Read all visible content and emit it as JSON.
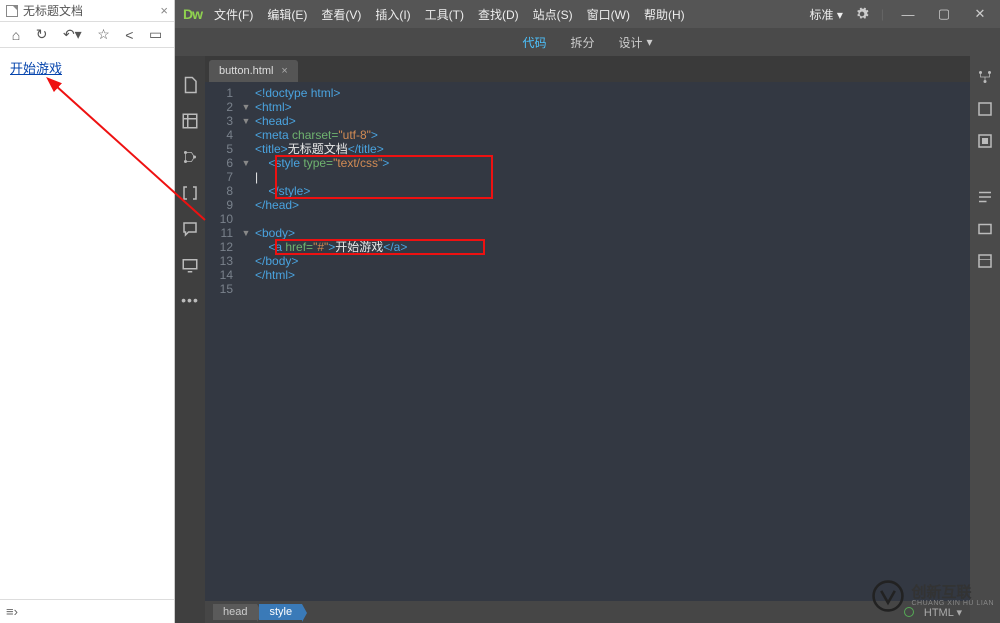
{
  "preview": {
    "title": "无标题文档",
    "link_text": "开始游戏",
    "bottom_icon": "≡›"
  },
  "menubar": {
    "logo": "Dw",
    "items": [
      "文件(F)",
      "编辑(E)",
      "查看(V)",
      "插入(I)",
      "工具(T)",
      "查找(D)",
      "站点(S)",
      "窗口(W)",
      "帮助(H)"
    ],
    "mode": "标准 ▾"
  },
  "viewbar": {
    "code": "代码",
    "split": "拆分",
    "design": "设计"
  },
  "tab": {
    "name": "button.html"
  },
  "code": {
    "lines": [
      {
        "n": "1",
        "fold": "",
        "html": "<span class='tag'>&lt;!doctype html&gt;</span>"
      },
      {
        "n": "2",
        "fold": "▼",
        "html": "<span class='tag'>&lt;html&gt;</span>"
      },
      {
        "n": "3",
        "fold": "▼",
        "html": "<span class='tag'>&lt;head&gt;</span>"
      },
      {
        "n": "4",
        "fold": "",
        "html": "<span class='tag'>&lt;meta</span> <span class='attr'>charset=</span><span class='str'>\"utf-8\"</span><span class='tag'>&gt;</span>"
      },
      {
        "n": "5",
        "fold": "",
        "html": "<span class='tag'>&lt;title&gt;</span><span class='txt'>无标题文档</span><span class='tag'>&lt;/title&gt;</span>"
      },
      {
        "n": "6",
        "fold": "▼",
        "html": "    <span class='tag'>&lt;style</span> <span class='attr'>type=</span><span class='str'>\"text/css\"</span><span class='tag'>&gt;</span>"
      },
      {
        "n": "7",
        "fold": "",
        "html": "<span class='txt'>|</span>"
      },
      {
        "n": "8",
        "fold": "",
        "html": "    <span class='tag'>&lt;/style&gt;</span>"
      },
      {
        "n": "9",
        "fold": "",
        "html": "<span class='tag'>&lt;/head&gt;</span>"
      },
      {
        "n": "10",
        "fold": "",
        "html": ""
      },
      {
        "n": "11",
        "fold": "▼",
        "html": "<span class='tag'>&lt;body&gt;</span>"
      },
      {
        "n": "12",
        "fold": "",
        "html": "    <span class='tag'>&lt;a</span> <span class='attr'>href=</span><span class='str'>\"#\"</span><span class='tag'>&gt;</span><span class='txt'>开始游戏</span><span class='tag'>&lt;/a&gt;</span>"
      },
      {
        "n": "13",
        "fold": "",
        "html": "<span class='tag'>&lt;/body&gt;</span>"
      },
      {
        "n": "14",
        "fold": "",
        "html": "<span class='tag'>&lt;/html&gt;</span>"
      },
      {
        "n": "15",
        "fold": "",
        "html": ""
      }
    ]
  },
  "breadcrumb": {
    "items": [
      "head",
      "style"
    ],
    "right": "HTML ▾"
  },
  "watermark": {
    "brand": "创新互联",
    "sub": "CHUANG XIN HU LIAN"
  }
}
